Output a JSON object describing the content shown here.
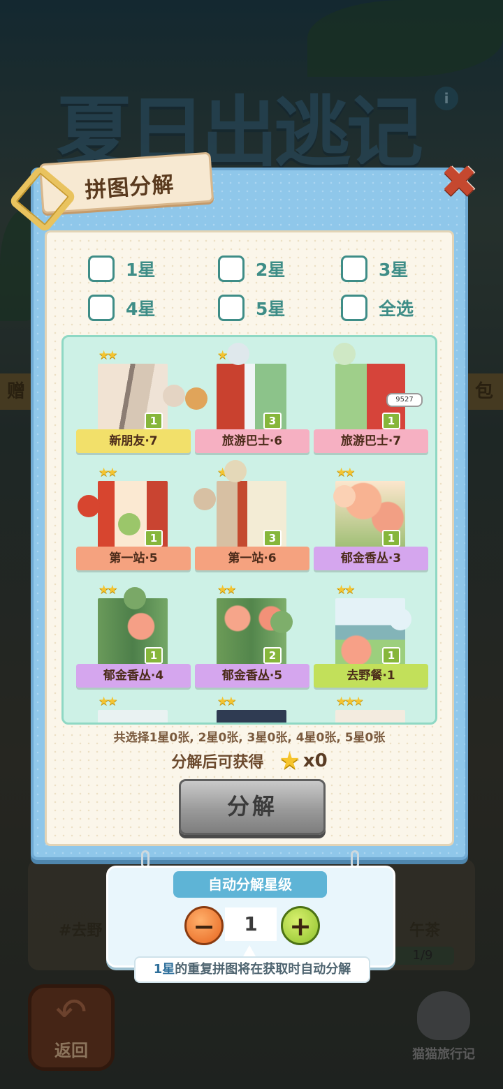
{
  "background": {
    "game_title": "夏日出逃记",
    "side_left_text": "赠",
    "side_right_text": "包",
    "card_left_text": "#去野",
    "card_right_text": "午茶",
    "card_count": "1/9",
    "back_label": "返回",
    "brand_label": "猫猫旅行记"
  },
  "modal": {
    "title": "拼图分解",
    "close_icon": "close-icon",
    "filters": [
      {
        "label": "1星",
        "checked": false
      },
      {
        "label": "2星",
        "checked": false
      },
      {
        "label": "3星",
        "checked": false
      },
      {
        "label": "4星",
        "checked": false
      },
      {
        "label": "5星",
        "checked": false
      },
      {
        "label": "全选",
        "checked": false
      }
    ],
    "pieces": [
      {
        "name": "新朋友·7",
        "stars": "★★",
        "count": "1",
        "ribbon": "yellow"
      },
      {
        "name": "旅游巴士·6",
        "stars": "★★",
        "count": "3",
        "ribbon": "pink"
      },
      {
        "name": "旅游巴士·7",
        "stars": "★★",
        "count": "1",
        "ribbon": "pink"
      },
      {
        "name": "第一站·5",
        "stars": "★★",
        "count": "1",
        "ribbon": "orange"
      },
      {
        "name": "第一站·6",
        "stars": "★★",
        "count": "3",
        "ribbon": "orange"
      },
      {
        "name": "郁金香丛·3",
        "stars": "★★",
        "count": "1",
        "ribbon": "purple"
      },
      {
        "name": "郁金香丛·4",
        "stars": "★★",
        "count": "1",
        "ribbon": "purple"
      },
      {
        "name": "郁金香丛·5",
        "stars": "★★",
        "count": "2",
        "ribbon": "purple"
      },
      {
        "name": "去野餐·1",
        "stars": "★★",
        "count": "1",
        "ribbon": "green"
      },
      {
        "name": "",
        "stars": "★★",
        "count": "",
        "ribbon": ""
      },
      {
        "name": "",
        "stars": "★★",
        "count": "",
        "ribbon": ""
      },
      {
        "name": "",
        "stars": "★★★",
        "count": "",
        "ribbon": ""
      }
    ],
    "bus_plate": "9527",
    "summary": "共选择1星0张, 2星0张, 3星0张, 4星0张, 5星0张",
    "reward_label": "分解后可获得",
    "reward_icon": "star-icon",
    "reward_count": "x0",
    "decompose_button": "分解"
  },
  "auto": {
    "title": "自动分解星级",
    "minus": "−",
    "plus": "+",
    "level": "1",
    "hint_highlight": "1星",
    "hint_rest": "的重复拼图将在获取时自动分解"
  },
  "colors": {
    "ribbon_yellow": "#f2e06a",
    "ribbon_pink": "#f6b0c2",
    "ribbon_orange": "#f5a27f",
    "ribbon_purple": "#d5a6ee",
    "ribbon_green": "#c2e05a",
    "checkbox_teal": "#3e8d87",
    "button_disabled_gray": "#9a9a9a"
  }
}
